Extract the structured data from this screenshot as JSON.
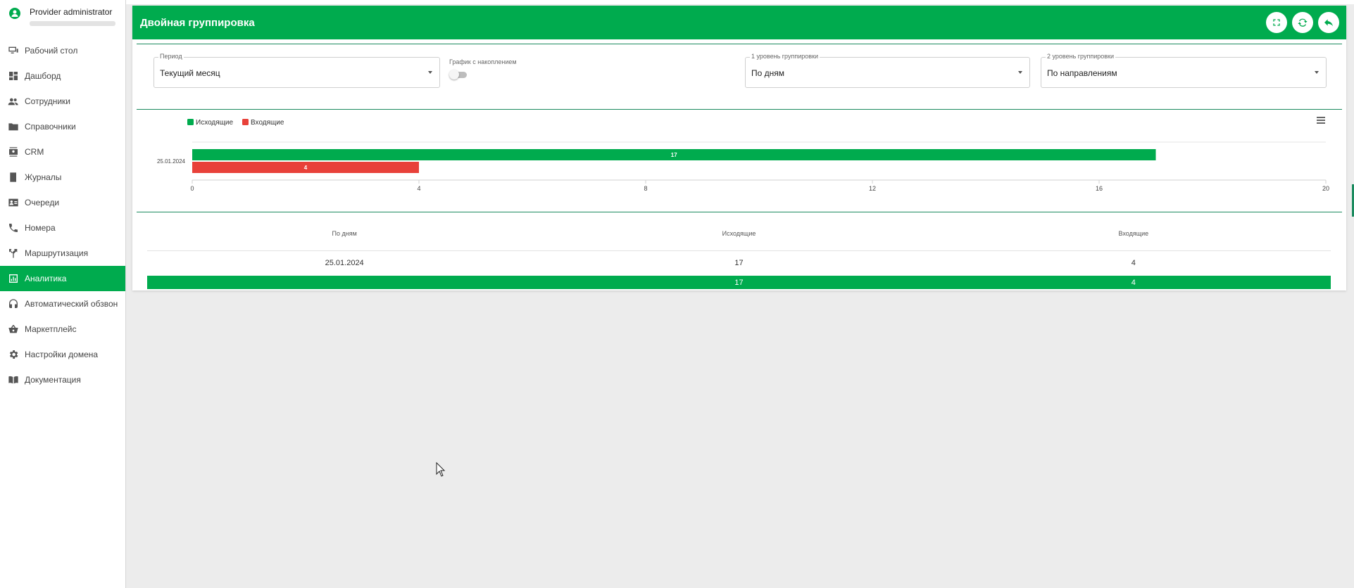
{
  "user": {
    "name": "Provider administrator"
  },
  "sidebar": {
    "items": [
      {
        "label": "Рабочий стол",
        "icon": "desktop-icon",
        "name": "desktop"
      },
      {
        "label": "Дашборд",
        "icon": "dashboard-icon",
        "name": "dashboard"
      },
      {
        "label": "Сотрудники",
        "icon": "people-icon",
        "name": "employees"
      },
      {
        "label": "Справочники",
        "icon": "folder-icon",
        "name": "directories"
      },
      {
        "label": "CRM",
        "icon": "contacts-icon",
        "name": "crm"
      },
      {
        "label": "Журналы",
        "icon": "book-icon",
        "name": "journals"
      },
      {
        "label": "Очереди",
        "icon": "contact-card-icon",
        "name": "queues"
      },
      {
        "label": "Номера",
        "icon": "phone-icon",
        "name": "numbers"
      },
      {
        "label": "Маршрутизация",
        "icon": "routing-icon",
        "name": "routing"
      },
      {
        "label": "Аналитика",
        "icon": "analytics-icon",
        "name": "analytics",
        "active": true
      },
      {
        "label": "Автоматический обзвон",
        "icon": "headset-icon",
        "name": "autodial"
      },
      {
        "label": "Маркетплейс",
        "icon": "basket-icon",
        "name": "marketplace"
      },
      {
        "label": "Настройки домена",
        "icon": "gear-icon",
        "name": "domain-settings"
      },
      {
        "label": "Документация",
        "icon": "docs-icon",
        "name": "documentation"
      }
    ]
  },
  "header": {
    "title": "Двойная группировка"
  },
  "filters": {
    "period": {
      "label": "Период",
      "value": "Текущий месяц"
    },
    "cumulative": {
      "label": "График с накоплением",
      "enabled": false
    },
    "level1": {
      "label": "1 уровень группировки",
      "value": "По дням"
    },
    "level2": {
      "label": "2 уровень группировки",
      "value": "По направлениям"
    }
  },
  "chart_data": {
    "type": "bar",
    "orientation": "horizontal",
    "categories": [
      "25.01.2024"
    ],
    "series": [
      {
        "name": "Исходящие",
        "values": [
          17
        ],
        "color": "#00ab4e"
      },
      {
        "name": "Входящие",
        "values": [
          4
        ],
        "color": "#e8413a"
      }
    ],
    "xlim": [
      0,
      20
    ],
    "xticks": [
      0,
      4,
      8,
      12,
      16,
      20
    ],
    "legend": "top-left",
    "grid": true
  },
  "table": {
    "headers": [
      "По дням",
      "Исходящие",
      "Входящие"
    ],
    "rows": [
      [
        "25.01.2024",
        "17",
        "4"
      ]
    ],
    "total": [
      "",
      "17",
      "4"
    ]
  },
  "colors": {
    "accent": "#00ab4e",
    "incoming": "#e8413a"
  }
}
